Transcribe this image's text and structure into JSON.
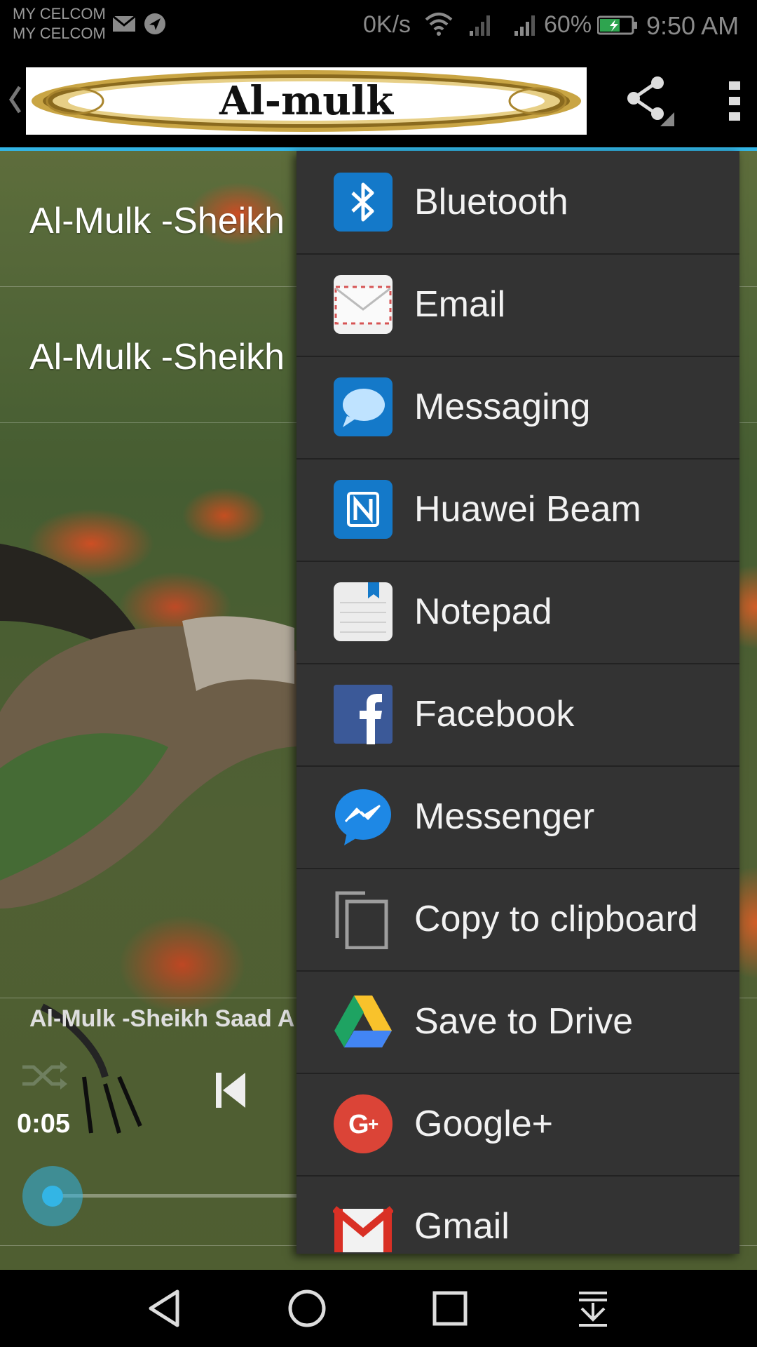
{
  "status_bar": {
    "carrier_1": "MY CELCOM",
    "carrier_2": "MY CELCOM",
    "net_speed": "0K/s",
    "battery": "60%",
    "time": "9:50 AM",
    "icons": [
      "mail-icon",
      "navigation-icon",
      "wifi-icon",
      "signal-icon",
      "signal-icon",
      "battery-icon"
    ]
  },
  "action_bar": {
    "title": "Al-mulk",
    "icons": [
      "back-chevron-icon",
      "share-icon",
      "overflow-menu-icon"
    ]
  },
  "playlist": {
    "tracks": [
      {
        "title": "Al-Mulk -Sheikh"
      },
      {
        "title": "Al-Mulk -Sheikh"
      }
    ]
  },
  "player": {
    "now_playing": "Al-Mulk -Sheikh Saad A",
    "elapsed": "0:05",
    "progress": 0.0,
    "icons": [
      "shuffle-icon",
      "previous-icon"
    ]
  },
  "share_menu": {
    "items": [
      {
        "label": "Bluetooth",
        "icon": "bluetooth-icon"
      },
      {
        "label": "Email",
        "icon": "email-icon"
      },
      {
        "label": "Messaging",
        "icon": "messaging-icon"
      },
      {
        "label": "Huawei Beam",
        "icon": "huawei-beam-icon"
      },
      {
        "label": "Notepad",
        "icon": "notepad-icon"
      },
      {
        "label": "Facebook",
        "icon": "facebook-icon"
      },
      {
        "label": "Messenger",
        "icon": "messenger-icon"
      },
      {
        "label": "Copy to clipboard",
        "icon": "copy-icon"
      },
      {
        "label": "Save to Drive",
        "icon": "drive-icon"
      },
      {
        "label": "Google+",
        "icon": "google-plus-icon"
      },
      {
        "label": "Gmail",
        "icon": "gmail-icon"
      }
    ]
  },
  "nav_bar": {
    "icons": [
      "back-icon",
      "home-icon",
      "recents-icon",
      "notification-pull-icon"
    ]
  },
  "colors": {
    "accent": "#33b5e5",
    "menu_background": "#333333"
  }
}
